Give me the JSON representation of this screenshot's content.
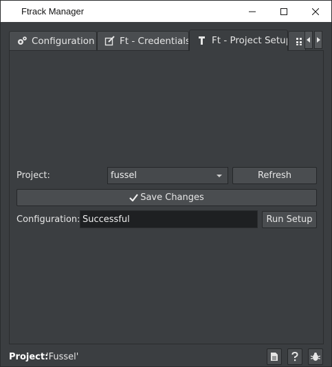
{
  "window": {
    "title": "Ftrack Manager"
  },
  "tabs": [
    {
      "label": "Configuration",
      "icon": "gears-icon"
    },
    {
      "label": "Ft - Credentials",
      "icon": "edit-icon"
    },
    {
      "label": "Ft - Project Setup",
      "icon": "wrench-icon",
      "active": true
    },
    {
      "label": "",
      "icon": "grid-icon"
    }
  ],
  "form": {
    "project_label": "Project:",
    "project_value": "fussel",
    "refresh_label": "Refresh",
    "save_label": "Save Changes",
    "configuration_label": "Configuration:",
    "configuration_value": "Successful",
    "run_setup_label": "Run Setup"
  },
  "status": {
    "project_label": "Project:",
    "project_value": "'Fussel'"
  },
  "colors": {
    "background": "#3b3e41",
    "field_dark": "#1e2022",
    "button": "#4a4d50"
  }
}
